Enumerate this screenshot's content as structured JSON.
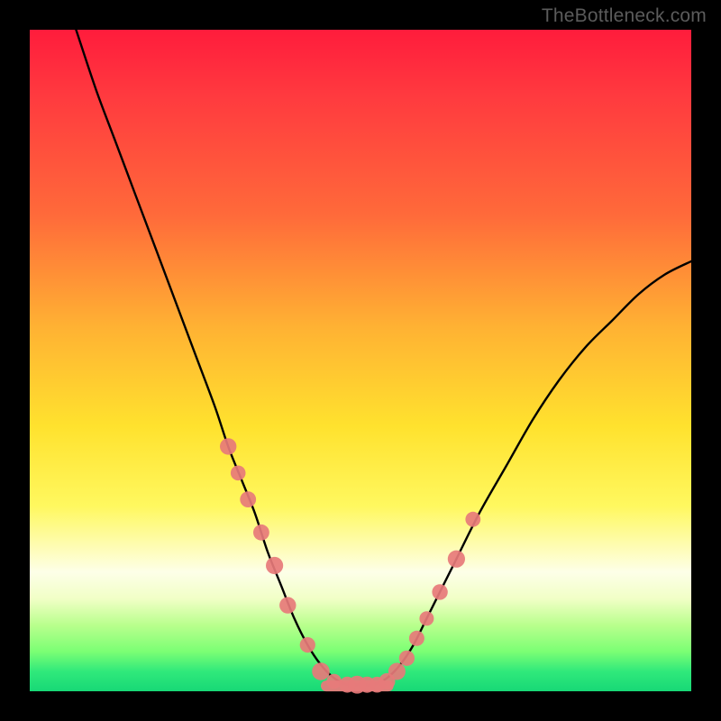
{
  "watermark": "TheBottleneck.com",
  "chart_data": {
    "type": "line",
    "title": "",
    "xlabel": "",
    "ylabel": "",
    "xlim": [
      0,
      100
    ],
    "ylim": [
      0,
      100
    ],
    "curve": {
      "name": "bottleneck-curve",
      "color": "#000000",
      "x": [
        7,
        10,
        13,
        16,
        19,
        22,
        25,
        28,
        30,
        32,
        34,
        36,
        38,
        40,
        42,
        44,
        46,
        48,
        50,
        52,
        54,
        56,
        58,
        60,
        64,
        68,
        72,
        76,
        80,
        84,
        88,
        92,
        96,
        100
      ],
      "y": [
        100,
        91,
        83,
        75,
        67,
        59,
        51,
        43,
        37,
        32,
        27,
        21,
        16,
        11,
        7,
        4,
        2,
        1,
        1,
        1,
        2,
        4,
        7,
        11,
        19,
        27,
        34,
        41,
        47,
        52,
        56,
        60,
        63,
        65
      ]
    },
    "highlight_points": {
      "name": "marker-points",
      "color": "#e77a7a",
      "x": [
        30,
        31.5,
        33,
        35,
        37,
        39,
        42,
        44,
        46,
        48,
        49.5,
        51,
        52.5,
        54,
        55.5,
        57,
        58.5,
        60,
        62,
        64.5,
        67
      ],
      "y": [
        37,
        33,
        29,
        24,
        19,
        13,
        7,
        3,
        1.5,
        1,
        1,
        1,
        1,
        1.5,
        3,
        5,
        8,
        11,
        15,
        20,
        26
      ]
    },
    "bottom_bar": {
      "name": "bottom-highlight",
      "color": "#e77a7a",
      "x_start": 44,
      "x_end": 55,
      "y": 0.8
    }
  }
}
